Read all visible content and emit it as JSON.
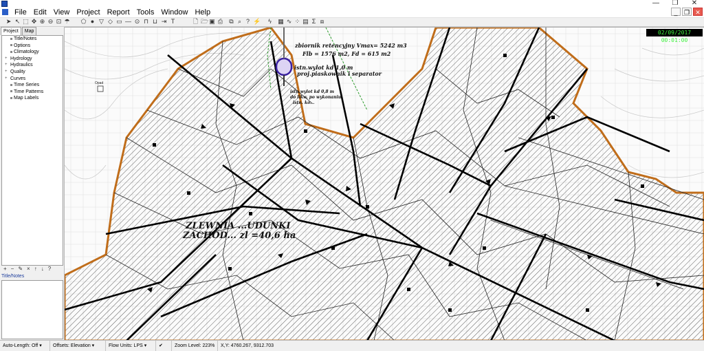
{
  "window": {
    "minimize_glyph": "—",
    "maximize_glyph": "❐",
    "close_glyph": "✕"
  },
  "menu": {
    "items": [
      "File",
      "Edit",
      "View",
      "Project",
      "Report",
      "Tools",
      "Window",
      "Help"
    ]
  },
  "mdi": {
    "minimize_glyph": "_",
    "restore_glyph": "❐",
    "close_glyph": "✕"
  },
  "sidebar": {
    "tabs": [
      "Project",
      "Map"
    ],
    "active_tab": "Project",
    "tree": [
      {
        "label": "Title/Notes",
        "expandable": false
      },
      {
        "label": "Options",
        "expandable": false
      },
      {
        "label": "Climatology",
        "expandable": false
      },
      {
        "label": "Hydrology",
        "expandable": true
      },
      {
        "label": "Hydraulics",
        "expandable": true
      },
      {
        "label": "Quality",
        "expandable": true
      },
      {
        "label": "Curves",
        "expandable": true
      },
      {
        "label": "Time Series",
        "expandable": false
      },
      {
        "label": "Time Patterns",
        "expandable": false
      },
      {
        "label": "Map Labels",
        "expandable": false
      }
    ],
    "tree_tools": [
      "+",
      "−",
      "✎",
      "×",
      "↑",
      "↓",
      "?"
    ],
    "notes_label": "Title/Notes"
  },
  "map": {
    "clock": "02/09/2017 00:01:00",
    "labels": {
      "retention": "zbiornik retencyjny Vmax= 5242 m3",
      "areas": "Flb = 1576 m2, Fd = 615 m2",
      "outlet_new": "istn.wylot kd 1,0 m",
      "separator": "proj.piaskownik i separator",
      "outlet_old": "istn.wylot kd 0,8 m",
      "outlet_old_2": "do likw. po wykonaniu",
      "outlet_old_3": "istn. ko...",
      "catchment_1": "ZLEWNIA ...UDUNKI",
      "catchment_2": "ZACHOD... zl =40,6 ha",
      "opad": "Opad"
    }
  },
  "status": {
    "auto_length": "Auto-Length: Off",
    "offsets": "Offsets: Elevation",
    "flow_units": "Flow Units: LPS",
    "zoom": "Zoom Level: 223%",
    "xy": "X,Y: 4760.267, 9312.703"
  }
}
